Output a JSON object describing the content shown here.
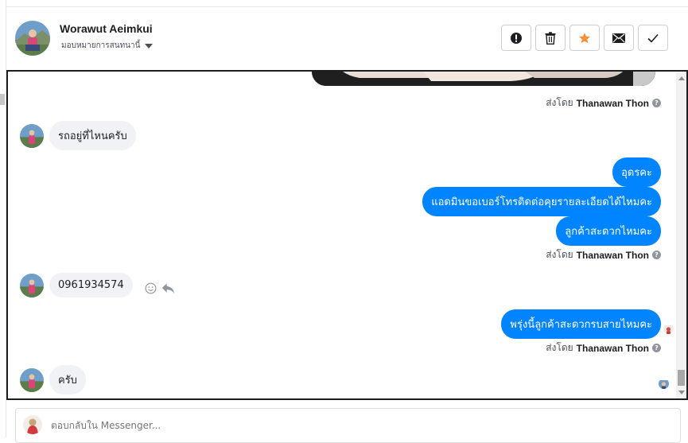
{
  "header": {
    "contact_name": "Worawut Aeimkui",
    "assign_label": "มอบหมายการสนทนานี้",
    "actions": [
      {
        "name": "mark-spam-button",
        "icon": "alert-icon"
      },
      {
        "name": "delete-button",
        "icon": "trash-icon"
      },
      {
        "name": "star-button",
        "icon": "star-icon",
        "color": "#f7923b"
      },
      {
        "name": "mark-unread-button",
        "icon": "envelope-icon"
      },
      {
        "name": "mark-done-button",
        "icon": "checkmark-icon"
      }
    ]
  },
  "conversation": {
    "sent_by_prefix": "ส่งโดย",
    "sent_by_name": "Thanawan Thon",
    "messages": [
      {
        "direction": "in",
        "text": "รถอยู่ที่ไหนครับ"
      },
      {
        "direction": "out",
        "text": "อุดรคะ"
      },
      {
        "direction": "out",
        "text": "แอดมินขอเบอร์โทรติดต่อคุยรายละเอียดได้ไหมคะ"
      },
      {
        "direction": "out",
        "text": "ลูกค้าสะดวกไหมคะ"
      },
      {
        "direction": "in",
        "text": "0961934574"
      },
      {
        "direction": "out",
        "text": "พรุ่งนี้ลูกค้าสะดวกรบสายไหมคะ"
      },
      {
        "direction": "in",
        "text": "ครับ"
      }
    ]
  },
  "composer": {
    "placeholder": "ตอบกลับใน Messenger..."
  },
  "colors": {
    "outgoing_bubble": "#0084ff",
    "incoming_bubble": "#f0f2f5",
    "star": "#f7923b"
  }
}
